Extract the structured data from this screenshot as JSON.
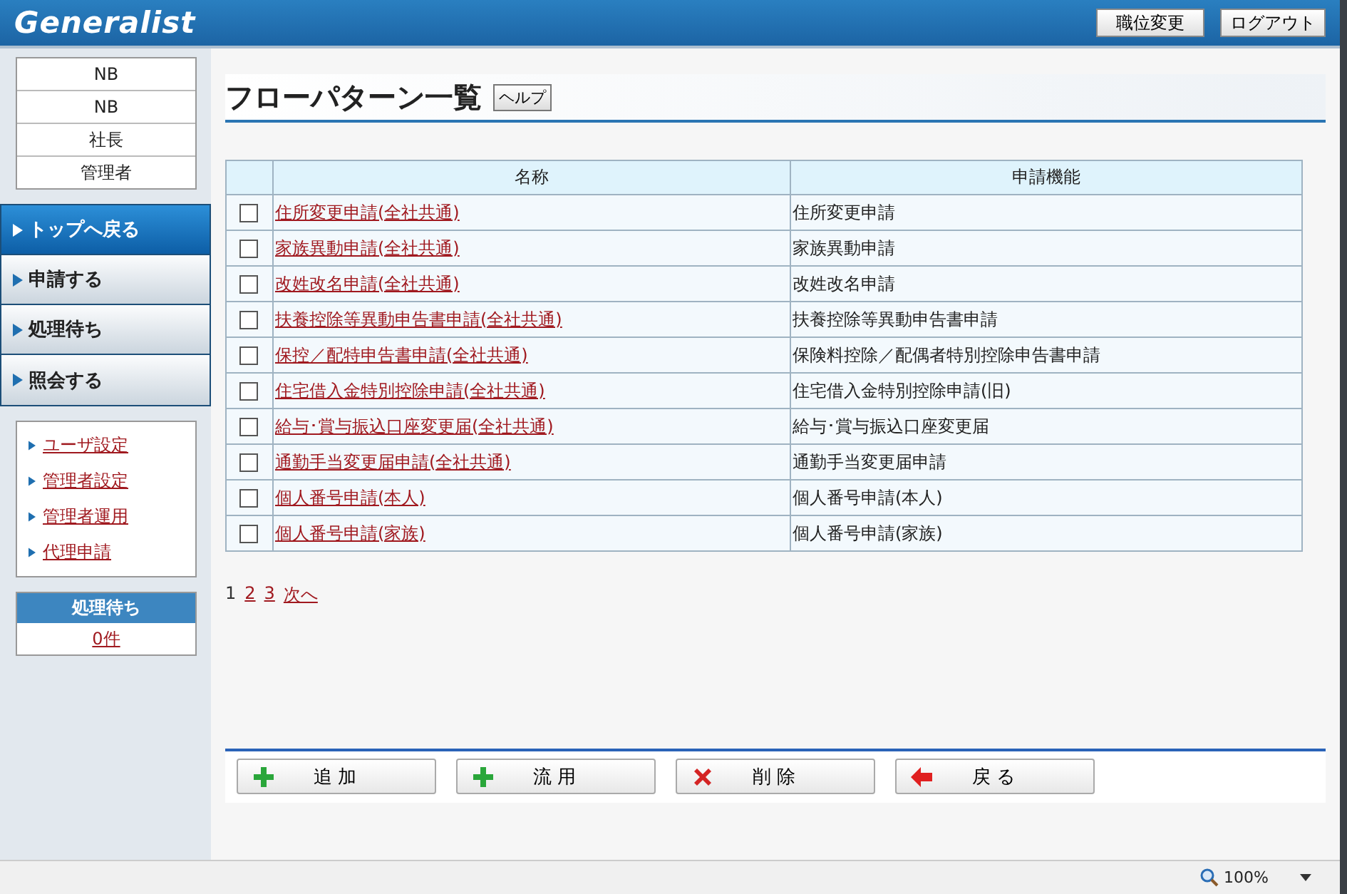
{
  "header": {
    "logo": "Generalist",
    "buttons": [
      "職位変更",
      "ログアウト"
    ]
  },
  "user_info": [
    "NB",
    "NB",
    "社長",
    "管理者"
  ],
  "nav": [
    {
      "label": "トップへ戻る",
      "selected": true
    },
    {
      "label": "申請する",
      "selected": false
    },
    {
      "label": "処理待ち",
      "selected": false
    },
    {
      "label": "照会する",
      "selected": false
    }
  ],
  "links": [
    "ユーザ設定",
    "管理者設定",
    "管理者運用",
    "代理申請"
  ],
  "pending": {
    "title": "処理待ち",
    "count": "0件"
  },
  "page": {
    "title": "フローパターン一覧",
    "help": "ヘルプ"
  },
  "table": {
    "columns": [
      "名称",
      "申請機能"
    ],
    "rows": [
      {
        "checked": false,
        "name": "住所変更申請(全社共通)",
        "function": "住所変更申請"
      },
      {
        "checked": false,
        "name": "家族異動申請(全社共通)",
        "function": "家族異動申請"
      },
      {
        "checked": false,
        "name": "改姓改名申請(全社共通)",
        "function": "改姓改名申請"
      },
      {
        "checked": false,
        "name": "扶養控除等異動申告書申請(全社共通)",
        "function": "扶養控除等異動申告書申請"
      },
      {
        "checked": false,
        "name": "保控／配特申告書申請(全社共通)",
        "function": "保険料控除／配偶者特別控除申告書申請"
      },
      {
        "checked": false,
        "name": "住宅借入金特別控除申請(全社共通)",
        "function": "住宅借入金特別控除申請(旧)"
      },
      {
        "checked": false,
        "name": "給与･賞与振込口座変更届(全社共通)",
        "function": "給与･賞与振込口座変更届"
      },
      {
        "checked": false,
        "name": "通勤手当変更届申請(全社共通)",
        "function": "通勤手当変更届申請"
      },
      {
        "checked": false,
        "name": "個人番号申請(本人)",
        "function": "個人番号申請(本人)"
      },
      {
        "checked": false,
        "name": "個人番号申請(家族)",
        "function": "個人番号申請(家族)"
      }
    ]
  },
  "pagination": [
    {
      "label": "1",
      "selected": true
    },
    {
      "label": "2",
      "selected": false
    },
    {
      "label": "3",
      "selected": false
    },
    {
      "label": "次へ",
      "selected": false
    }
  ],
  "actions": [
    {
      "kind": "add",
      "label": "追 加"
    },
    {
      "kind": "copy",
      "label": "流 用"
    },
    {
      "kind": "delete",
      "label": "削 除"
    },
    {
      "kind": "back",
      "label": "戻 る"
    }
  ],
  "status_bar": {
    "zoom": "100%"
  }
}
